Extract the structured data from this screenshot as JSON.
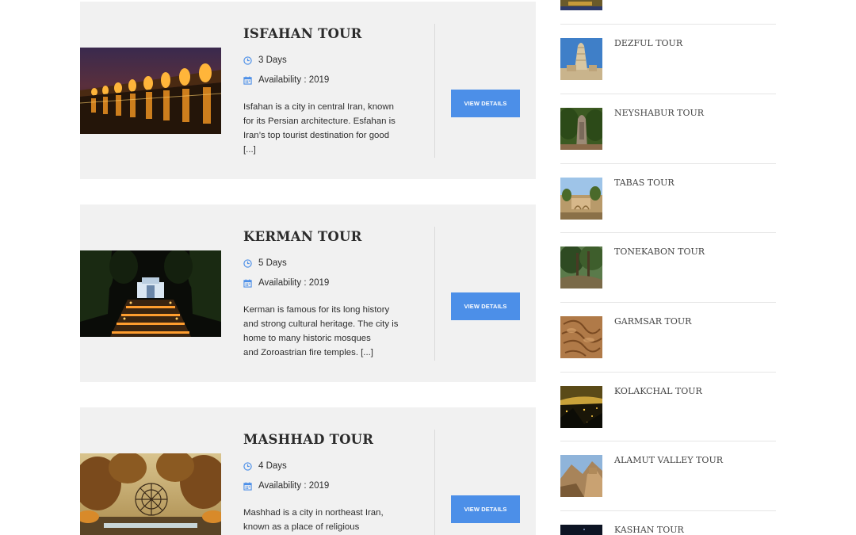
{
  "tours": [
    {
      "title": "ISFAHAN TOUR",
      "duration": "3 Days",
      "availability": "Availability : 2019",
      "desc_lines": [
        "Isfahan is a city in central Iran, known",
        "for its Persian architecture. Esfahan is",
        "Iran’s top tourist destination for good",
        "[...]"
      ],
      "button": "VIEW DETAILS"
    },
    {
      "title": "KERMAN TOUR",
      "duration": "5 Days",
      "availability": "Availability : 2019",
      "desc_lines": [
        "Kerman is famous for its long history",
        "and strong cultural heritage. The city is",
        "home to many historic mosques",
        "and Zoroastrian fire temples. [...]"
      ],
      "button": "VIEW DETAILS"
    },
    {
      "title": "MASHHAD TOUR",
      "duration": "4 Days",
      "availability": "Availability : 2019",
      "desc_lines": [
        "Mashhad is a city in northeast Iran,",
        "known as a place of religious"
      ],
      "button": "VIEW DETAILS"
    }
  ],
  "sidebar": {
    "items": [
      {
        "title": "DEZFUL TOUR"
      },
      {
        "title": "NEYSHABUR TOUR"
      },
      {
        "title": "TABAS TOUR"
      },
      {
        "title": "TONEKABON TOUR"
      },
      {
        "title": "GARMSAR TOUR"
      },
      {
        "title": "KOLAKCHAL TOUR"
      },
      {
        "title": "ALAMUT VALLEY TOUR"
      },
      {
        "title": "KASHAN TOUR"
      }
    ]
  },
  "colors": {
    "accent": "#4c8fe8",
    "card_bg": "#f1f1f1",
    "divider": "#e6e6e6"
  },
  "icons": {
    "duration": "clock-icon",
    "availability": "calendar-icon"
  }
}
